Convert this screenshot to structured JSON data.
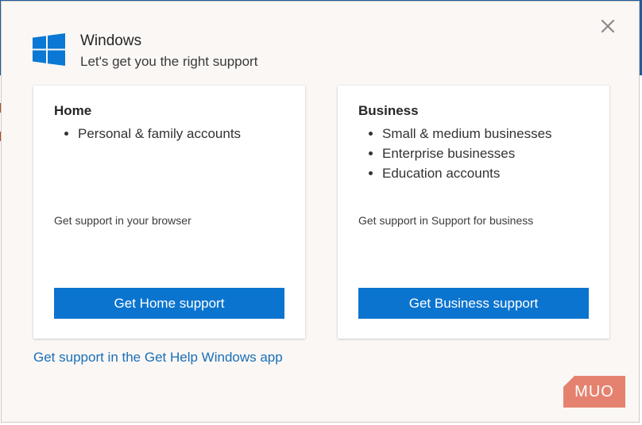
{
  "dialog": {
    "app_title": "Windows",
    "subtitle": "Let's get you the right support",
    "close_icon": "close-icon",
    "logo_icon": "windows-logo"
  },
  "cards": {
    "home": {
      "title": "Home",
      "items": [
        "Personal & family accounts"
      ],
      "description": "Get support in your browser",
      "button_label": "Get Home support"
    },
    "business": {
      "title": "Business",
      "items": [
        "Small & medium businesses",
        "Enterprise businesses",
        "Education accounts"
      ],
      "description": "Get support in Support for business",
      "button_label": "Get Business support"
    }
  },
  "footer_link": "Get support in the Get Help Windows app",
  "watermark": "MUO",
  "colors": {
    "accent": "#0b74cf",
    "link": "#1a6fb7",
    "dialog_bg": "#faf7f5",
    "watermark_bg": "#e5826f"
  }
}
